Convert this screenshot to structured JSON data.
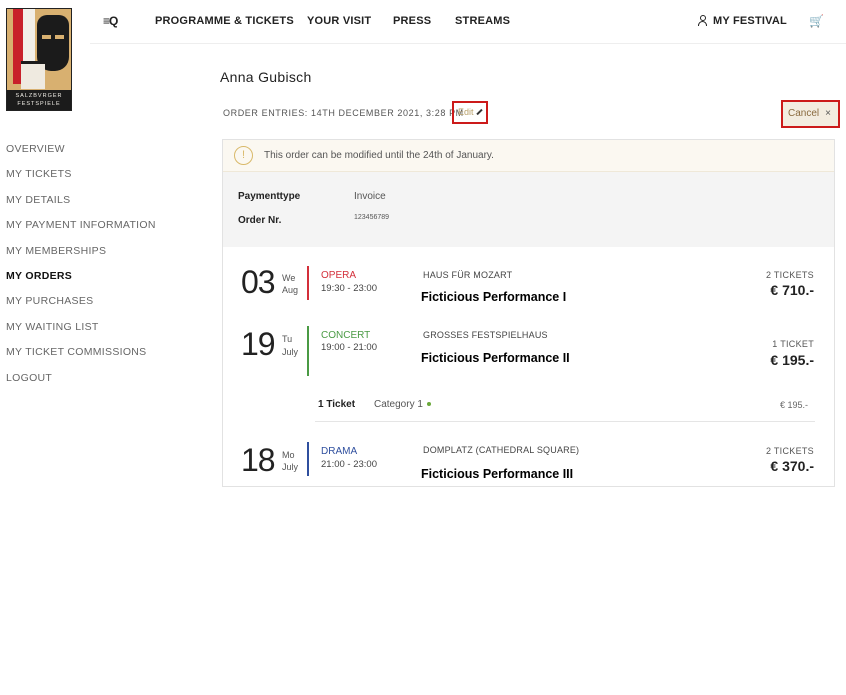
{
  "logo": {
    "text": "SALZBVRGER FESTSPIELE"
  },
  "nav": {
    "menu_icon": "≡Q",
    "items": [
      "PROGRAMME & TICKETS",
      "YOUR VISIT",
      "PRESS",
      "STREAMS"
    ],
    "my_festival": "MY FESTIVAL",
    "cart_icon": "🛒"
  },
  "sidebar": {
    "items": [
      "OVERVIEW",
      "MY TICKETS",
      "MY DETAILS",
      "MY PAYMENT INFORMATION",
      "MY MEMBERSHIPS",
      "MY ORDERS",
      "MY PURCHASES",
      "MY WAITING LIST",
      "MY TICKET COMMISSIONS",
      "LOGOUT"
    ],
    "active": "MY ORDERS"
  },
  "page": {
    "name": "Anna Gubisch",
    "order_meta": "ORDER ENTRIES: 14TH DECEMBER 2021, 3:28 PM",
    "edit_label": "Edit",
    "cancel_label": "Cancel",
    "cancel_x": "×"
  },
  "notice": {
    "icon": "!",
    "text": "This order can be modified until the 24th of January."
  },
  "info": {
    "payment_label": "Paymenttype",
    "payment_value": "Invoice",
    "order_label": "Order Nr.",
    "order_value": "123456789"
  },
  "performances": [
    {
      "day": "03",
      "weekday": "We",
      "month": "Aug",
      "genre": "OPERA",
      "genre_color": "#d32f3a",
      "time": "19:30 - 23:00",
      "venue": "HAUS FÜR MOZART",
      "title": "Ficticious Performance I",
      "tickets": "2 TICKETS",
      "price": "€ 710.-"
    },
    {
      "day": "19",
      "weekday": "Tu",
      "month": "July",
      "genre": "CONCERT",
      "genre_color": "#4a9a44",
      "time": "19:00 - 21:00",
      "venue": "GROSSES FESTSPIELHAUS",
      "title": "Ficticious Performance II",
      "tickets": "1 TICKET",
      "price": "€ 195.-"
    },
    {
      "day": "18",
      "weekday": "Mo",
      "month": "July",
      "genre": "DRAMA",
      "genre_color": "#2f4f9e",
      "time": "21:00 - 23:00",
      "venue": "DOMPLATZ (CATHEDRAL SQUARE)",
      "title": "Ficticious Performance III",
      "tickets": "2 TICKETS",
      "price": "€ 370.-"
    }
  ],
  "ticket_detail": {
    "qty": "1 Ticket",
    "category": "Category 1",
    "price": "€ 195.-"
  }
}
